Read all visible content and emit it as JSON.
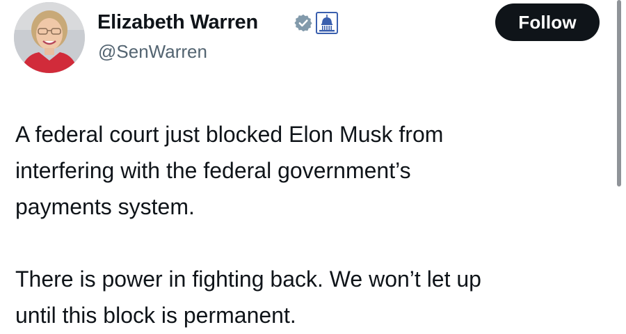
{
  "author": {
    "display_name": "Elizabeth Warren",
    "handle": "@SenWarren",
    "verified_badge_icon": "verified-badge-icon",
    "affiliation_badge_icon": "capitol-dome-icon",
    "avatar_description": "avatar"
  },
  "actions": {
    "follow_label": "Follow"
  },
  "tweet": {
    "paragraphs": [
      "A federal court just blocked Elon Musk from\ninterfering with the federal government’s\npayments system.",
      "There is power in fighting back. We won’t let up\nuntil this block is permanent."
    ]
  },
  "colors": {
    "text_primary": "#0f1419",
    "text_secondary": "#536471",
    "follow_bg": "#0f1419",
    "verified_badge": "#829aab",
    "affiliation_badge": "#3a5fae"
  }
}
